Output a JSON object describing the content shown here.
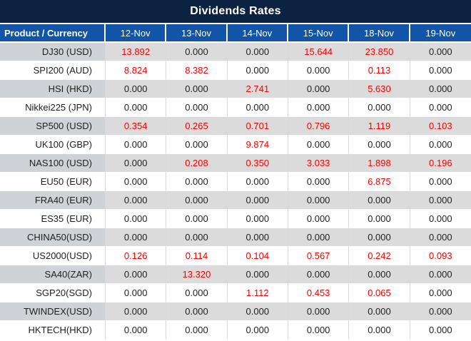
{
  "title": "Dividends Rates",
  "colors": {
    "title_bg": "#0B2240",
    "header_bg": "#1154A8",
    "header_text": "#FFFFFF",
    "row_stripe_product_bg": "#CFD3D8",
    "row_stripe_value_bg": "#DBDBDB",
    "nonzero_value_red": "#FA0000",
    "zero_value_text": "#1F1F1F",
    "grid_line": "#D9D9D9"
  },
  "chart_data": {
    "type": "table",
    "title": "Dividends Rates",
    "columns": [
      "Product / Currency",
      "12-Nov",
      "13-Nov",
      "14-Nov",
      "15-Nov",
      "18-Nov",
      "19-Nov"
    ],
    "rows": [
      [
        "DJ30 (USD)",
        "13.892",
        "0.000",
        "0.000",
        "15.644",
        "23.850",
        "0.000"
      ],
      [
        "SPI200 (AUD)",
        "8.824",
        "8.382",
        "0.000",
        "0.000",
        "0.113",
        "0.000"
      ],
      [
        "HSI (HKD)",
        "0.000",
        "0.000",
        "2.741",
        "0.000",
        "5.630",
        "0.000"
      ],
      [
        "Nikkei225 (JPN)",
        "0.000",
        "0.000",
        "0.000",
        "0.000",
        "0.000",
        "0.000"
      ],
      [
        "SP500 (USD)",
        "0.354",
        "0.265",
        "0.701",
        "0.796",
        "1.119",
        "0.103"
      ],
      [
        "UK100 (GBP)",
        "0.000",
        "0.000",
        "9.874",
        "0.000",
        "0.000",
        "0.000"
      ],
      [
        "NAS100 (USD)",
        "0.000",
        "0.208",
        "0.350",
        "3.033",
        "1.898",
        "0.196"
      ],
      [
        "EU50 (EUR)",
        "0.000",
        "0.000",
        "0.000",
        "0.000",
        "6.875",
        "0.000"
      ],
      [
        "FRA40 (EUR)",
        "0.000",
        "0.000",
        "0.000",
        "0.000",
        "0.000",
        "0.000"
      ],
      [
        "ES35 (EUR)",
        "0.000",
        "0.000",
        "0.000",
        "0.000",
        "0.000",
        "0.000"
      ],
      [
        "CHINA50(USD)",
        "0.000",
        "0.000",
        "0.000",
        "0.000",
        "0.000",
        "0.000"
      ],
      [
        "US2000(USD)",
        "0.126",
        "0.114",
        "0.104",
        "0.567",
        "0.242",
        "0.093"
      ],
      [
        "SA40(ZAR)",
        "0.000",
        "13.320",
        "0.000",
        "0.000",
        "0.000",
        "0.000"
      ],
      [
        "SGP20(SGD)",
        "0.000",
        "0.000",
        "1.112",
        "0.453",
        "0.065",
        "0.000"
      ],
      [
        "TWINDEX(USD)",
        "0.000",
        "0.000",
        "0.000",
        "0.000",
        "0.000",
        "0.000"
      ],
      [
        "HKTECH(HKD)",
        "0.000",
        "0.000",
        "0.000",
        "0.000",
        "0.000",
        "0.000"
      ]
    ]
  }
}
